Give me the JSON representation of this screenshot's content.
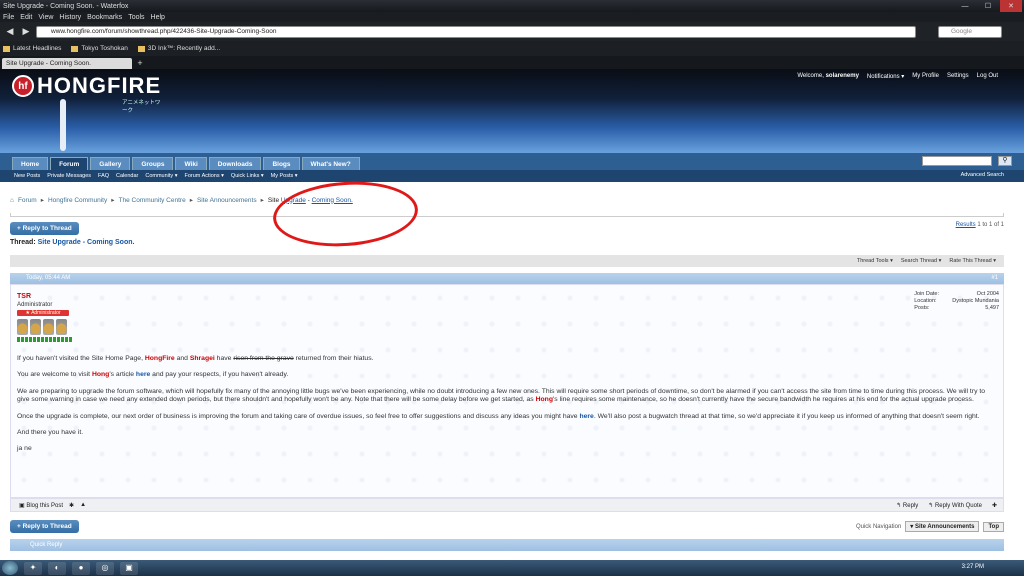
{
  "window": {
    "title": "Site Upgrade - Coming Soon. - Waterfox",
    "minimize": "—",
    "maximize": "☐",
    "close": "✕"
  },
  "menu": [
    "File",
    "Edit",
    "View",
    "History",
    "Bookmarks",
    "Tools",
    "Help"
  ],
  "browser": {
    "url": "www.hongfire.com/forum/showthread.php/422436-Site-Upgrade-Coming-Soon",
    "search_placeholder": "Google"
  },
  "bookmarks": [
    "Latest Headlines",
    "Tokyo Toshokan",
    "3D Ink™: Recently add..."
  ],
  "tab": {
    "title": "Site Upgrade - Coming Soon.",
    "new": "+"
  },
  "site": {
    "logo": "HONGFIRE",
    "logo_sub": "アニメネットワーク",
    "logo_letter": "hf",
    "user_welcome": "Welcome,",
    "username": "solarenemy",
    "user_links": [
      "Notifications ▾",
      "My Profile",
      "Settings",
      "Log Out"
    ],
    "nav_tabs": [
      "Home",
      "Forum",
      "Gallery",
      "Groups",
      "Wiki",
      "Downloads",
      "Blogs",
      "What's New?"
    ],
    "sub_nav": [
      "New Posts",
      "Private Messages",
      "FAQ",
      "Calendar",
      "Community ▾",
      "Forum Actions ▾",
      "Quick Links ▾",
      "My Posts ▾"
    ],
    "advanced_search": "Advanced Search",
    "search_btn": "⚲"
  },
  "breadcrumb": {
    "home": "⌂",
    "items": [
      "Forum",
      "Hongfire Community",
      "The Community Centre",
      "Site Announcements"
    ],
    "current_prefix": "Site",
    "current_a": "Upgrade",
    "current_b": "Coming Soon."
  },
  "thread": {
    "reply_btn": "+ Reply to Thread",
    "results_label": "Results",
    "results_rest": "1 to 1 of 1",
    "label": "Thread:",
    "title": "Site Upgrade - Coming Soon.",
    "tools": [
      "Thread Tools ▾",
      "Search Thread ▾",
      "Rate This Thread ▾"
    ]
  },
  "post": {
    "date": "Today,",
    "time": "05:44 AM",
    "num": "#1",
    "username": "TSR",
    "user_title": "Administrator",
    "rank": "★ Administrator",
    "info": [
      {
        "k": "Join Date:",
        "v": "Oct 2004"
      },
      {
        "k": "Location:",
        "v": "Dystopic Mundania"
      },
      {
        "k": "Posts:",
        "v": "5,497"
      }
    ],
    "p1a": "If you haven't visited the Site Home Page,",
    "p1_hf": "HongFire",
    "p1_and": "and",
    "p1_sh": "Shragei",
    "p1_have": "have",
    "p1_strike": "risen from the grave",
    "p1_end": "returned from their hiatus.",
    "p2a": "You are welcome to visit",
    "p2_hong": "Hong",
    "p2_b": "'s article",
    "p2_here": "here",
    "p2_c": "and pay your respects, if you haven't already.",
    "p3a": "We are preparing to upgrade the forum software, which will hopefully fix many of the annoying little bugs we've been experiencing, while no doubt introducing a few new ones. This will require some short periods of downtime, so don't be alarmed if you can't access the site from time to time during this process. We will try to give some warning in case we need any extended down periods, but there shouldn't and hopefully won't be any. Note that there will be some delay before we get started, as",
    "p3_hong": "Hong",
    "p3_b": "'s line requires some maintenance, so he doesn't currently have the secure bandwidth he requires at his end for the actual upgrade process.",
    "p4a": "Once the upgrade is complete, our next order of business is improving the forum and taking care of overdue issues, so feel free to offer suggestions and discuss any ideas you might have",
    "p4_here": "here",
    "p4_b": ". We'll also post a bugwatch thread at that time, so we'd appreciate it if you keep us informed of anything that doesn't seem right.",
    "p5": "And there you have it.",
    "p6": "ja ne",
    "foot_blog": "Blog this Post",
    "foot_reply": "↰ Reply",
    "foot_quote": "↰ Reply With Quote",
    "foot_multi": "✚"
  },
  "bottom": {
    "reply_btn": "+ Reply to Thread",
    "quicknav_label": "Quick Navigation",
    "quicknav_value": "▾ Site Announcements",
    "top": "Top",
    "quick_reply": "Quick Reply"
  },
  "taskbar": {
    "clock": "3:27 PM"
  }
}
